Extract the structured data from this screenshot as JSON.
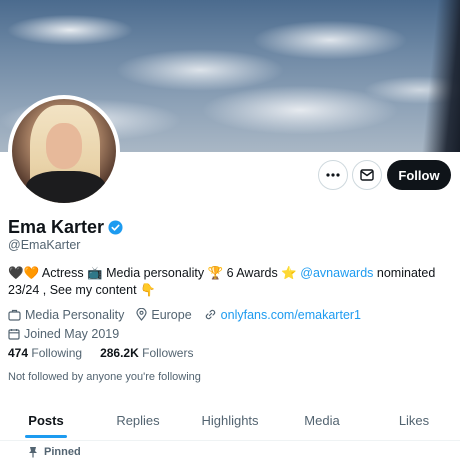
{
  "profile": {
    "name": "Ema Karter",
    "handle": "@EmaKarter",
    "verified": true,
    "bio": {
      "part1": "🖤🧡 Actress 📺 Media personality 🏆 6 Awards ⭐ ",
      "mention": "@avnawards",
      "part2": " nominated 23/24 , See my content 👇"
    },
    "category": "Media Personality",
    "location": "Europe",
    "website": "onlyfans.com/emakarter1",
    "joined": "Joined May 2019"
  },
  "actions": {
    "more_icon": "more-icon",
    "message_icon": "mail-icon",
    "follow_label": "Follow"
  },
  "stats": {
    "following_count": "474",
    "following_label": "Following",
    "followers_count": "286.2K",
    "followers_label": "Followers"
  },
  "note": "Not followed by anyone you're following",
  "tabs": [
    {
      "label": "Posts",
      "active": true
    },
    {
      "label": "Replies",
      "active": false
    },
    {
      "label": "Highlights",
      "active": false
    },
    {
      "label": "Media",
      "active": false
    },
    {
      "label": "Likes",
      "active": false
    }
  ],
  "pinned_label": "Pinned",
  "colors": {
    "accent": "#1d9bf0",
    "text": "#0f1419",
    "muted": "#536471",
    "follow_bg": "#0f1419"
  }
}
